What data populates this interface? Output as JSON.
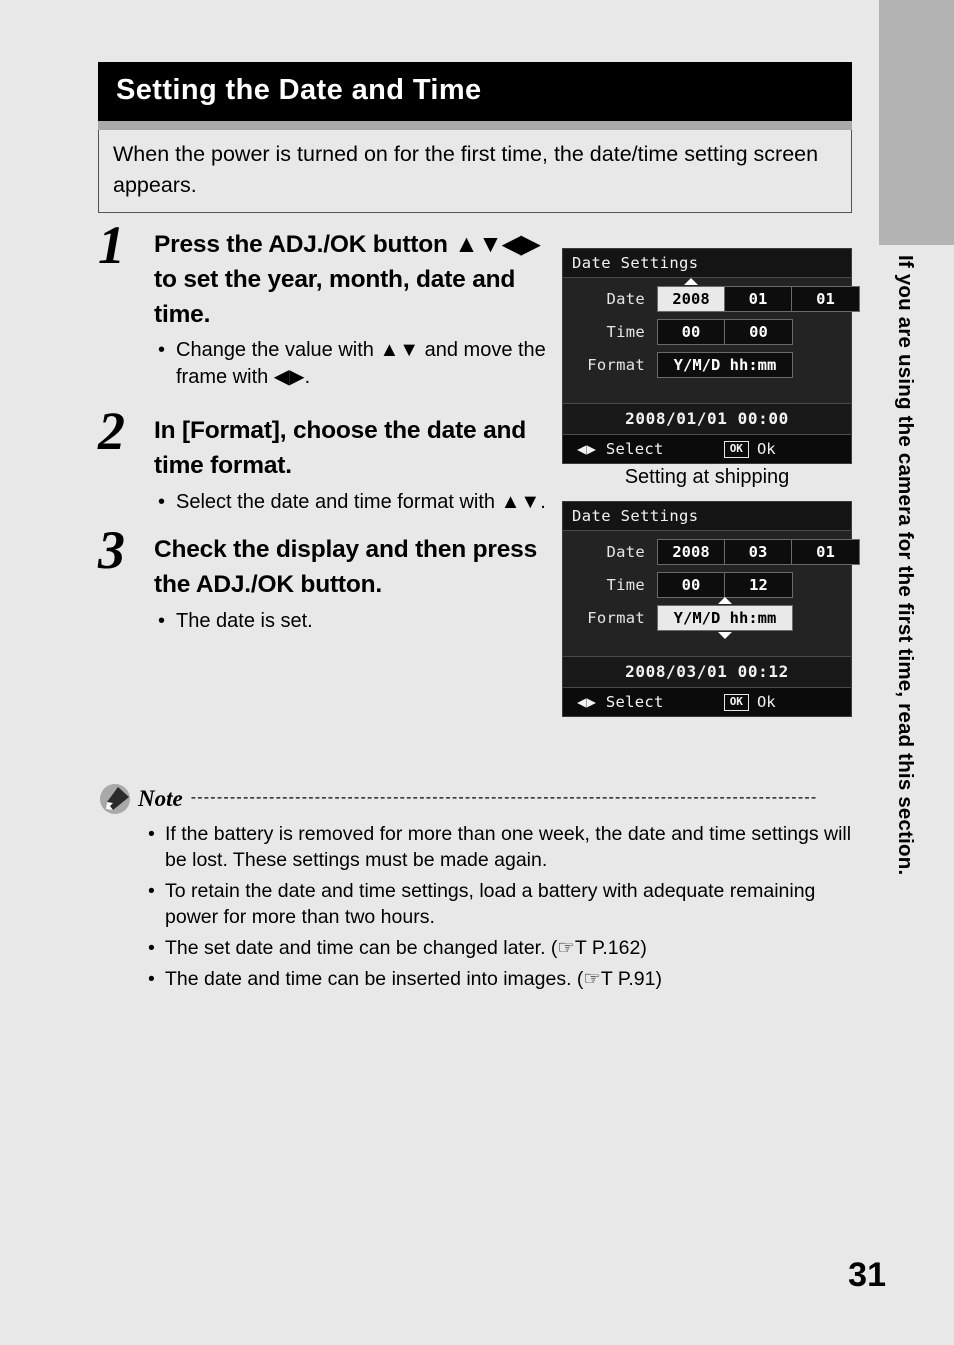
{
  "page": {
    "number": "31",
    "background_color": "#e8e8e8"
  },
  "side_tab": {
    "color": "#b3b3b3",
    "vertical_text": "If you are using the camera for the first time, read this section."
  },
  "header": {
    "title": "Setting the Date and Time",
    "background_color": "#000000",
    "rule_color": "#aaaaaa"
  },
  "intro": {
    "text": "When the power is turned on for the first time, the date/time setting screen appears."
  },
  "steps": [
    {
      "number": "1",
      "title": "Press the ADJ./OK button ▲▼◀▶ to set the year, month, date and time.",
      "bullets": [
        {
          "dot": "•",
          "text": "Change the value with ▲▼ and move the frame with ◀▶."
        }
      ]
    },
    {
      "number": "2",
      "title": "In [Format], choose the date and time format.",
      "bullets": [
        {
          "dot": "•",
          "text": "Select the date and time format with ▲▼."
        }
      ]
    },
    {
      "number": "3",
      "title": "Check the display and then press the ADJ./OK button.",
      "bullets": [
        {
          "dot": "•",
          "text": "The date is set."
        }
      ]
    }
  ],
  "camera_screens": [
    {
      "title": "Date Settings",
      "rows": [
        {
          "label": "Date",
          "fields": [
            {
              "value": "2008",
              "selected": true,
              "arrow_up": true,
              "arrow_down": false
            },
            {
              "value": "01",
              "selected": false,
              "arrow_up": false,
              "arrow_down": false
            },
            {
              "value": "01",
              "selected": false,
              "arrow_up": false,
              "arrow_down": false
            }
          ]
        },
        {
          "label": "Time",
          "fields": [
            {
              "value": "00",
              "selected": false,
              "arrow_up": false,
              "arrow_down": false
            },
            {
              "value": "00",
              "selected": false,
              "arrow_up": false,
              "arrow_down": false
            }
          ]
        },
        {
          "label": "Format",
          "fields": [
            {
              "value": "Y/M/D hh:mm",
              "selected": false,
              "arrow_up": false,
              "arrow_down": false,
              "wide": true
            }
          ]
        }
      ],
      "summary": "2008/01/01  00:00",
      "footer": {
        "select_label": "◀▶ Select",
        "ok_key": "OK",
        "ok_label": "Ok"
      }
    },
    {
      "title": "Date Settings",
      "rows": [
        {
          "label": "Date",
          "fields": [
            {
              "value": "2008",
              "selected": false,
              "arrow_up": false,
              "arrow_down": false
            },
            {
              "value": "03",
              "selected": false,
              "arrow_up": false,
              "arrow_down": false
            },
            {
              "value": "01",
              "selected": false,
              "arrow_up": false,
              "arrow_down": false
            }
          ]
        },
        {
          "label": "Time",
          "fields": [
            {
              "value": "00",
              "selected": false,
              "arrow_up": false,
              "arrow_down": false
            },
            {
              "value": "12",
              "selected": false,
              "arrow_up": false,
              "arrow_down": false
            }
          ]
        },
        {
          "label": "Format",
          "fields": [
            {
              "value": "Y/M/D hh:mm",
              "selected": true,
              "arrow_up": true,
              "arrow_down": true,
              "wide": true
            }
          ]
        }
      ],
      "summary": "2008/03/01  00:12",
      "footer": {
        "select_label": "◀▶ Select",
        "ok_key": "OK",
        "ok_label": "Ok"
      }
    }
  ],
  "camera_caption": "Setting at shipping",
  "note": {
    "label": "Note",
    "dashes": "------------------------------------------------------------------------------------------------",
    "items": [
      {
        "dot": "•",
        "text": "If the battery is removed for more than one week, the date and time settings will be lost. These settings must be made again."
      },
      {
        "dot": "•",
        "text": "To retain the date and time settings, load a battery with adequate remaining power for more than two hours."
      },
      {
        "dot": "•",
        "text": "The set date and time can be changed later. (☞T P.162)"
      },
      {
        "dot": "•",
        "text": "The date and time can be inserted into images. (☞T P.91)"
      }
    ]
  }
}
